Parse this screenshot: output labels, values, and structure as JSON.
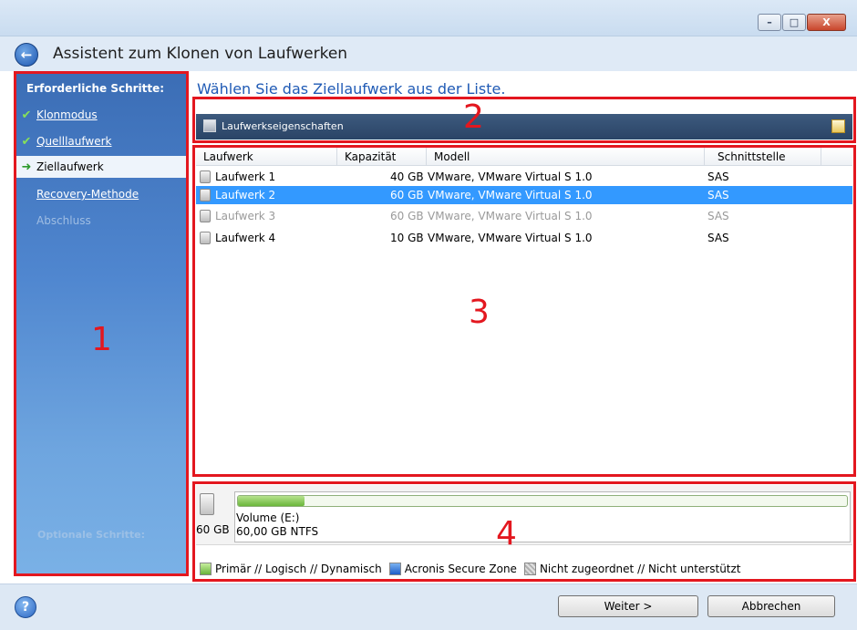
{
  "window": {
    "title": "Assistent zum Klonen von Laufwerken",
    "controls": {
      "minimize": "–",
      "maximize": "□",
      "close": "X"
    }
  },
  "sidebar": {
    "required_heading": "Erforderliche Schritte:",
    "steps": [
      {
        "label": "Klonmodus",
        "state": "done"
      },
      {
        "label": "Quelllaufwerk",
        "state": "done"
      },
      {
        "label": "Ziellaufwerk",
        "state": "current"
      },
      {
        "label": "Recovery-Methode",
        "state": "pending"
      },
      {
        "label": "Abschluss",
        "state": "disabled"
      }
    ],
    "optional_heading": "Optionale Schritte:"
  },
  "main": {
    "instruction": "Wählen Sie das Ziellaufwerk aus der Liste.",
    "toolbar": {
      "properties_label": "Laufwerkseigenschaften"
    },
    "table": {
      "columns": [
        "Laufwerk",
        "Kapazität",
        "Modell",
        "Schnittstelle"
      ],
      "rows": [
        {
          "drive": "Laufwerk 1",
          "capacity": "40 GB",
          "model": "VMware, VMware Virtual S 1.0",
          "interface": "SAS",
          "state": "normal"
        },
        {
          "drive": "Laufwerk 2",
          "capacity": "60 GB",
          "model": "VMware, VMware Virtual S 1.0",
          "interface": "SAS",
          "state": "selected"
        },
        {
          "drive": "Laufwerk 3",
          "capacity": "60 GB",
          "model": "VMware, VMware Virtual S 1.0",
          "interface": "SAS",
          "state": "disabled"
        },
        {
          "drive": "Laufwerk 4",
          "capacity": "10 GB",
          "model": "VMware, VMware Virtual S 1.0",
          "interface": "SAS",
          "state": "normal"
        }
      ]
    },
    "disk_map": {
      "disk_size": "60 GB",
      "volume_name": "Volume (E:)",
      "volume_info": "60,00 GB  NTFS",
      "used_fraction": 0.11
    },
    "legend": [
      {
        "label": "Primär // Logisch // Dynamisch",
        "color": "#6ab63a"
      },
      {
        "label": "Acronis Secure Zone",
        "color": "#1c5cc7"
      },
      {
        "label": "Nicht zugeordnet // Nicht unterstützt",
        "color": "#b0b0b0"
      }
    ]
  },
  "annotations": {
    "n1": "1",
    "n2": "2",
    "n3": "3",
    "n4": "4",
    "color": "#e3171f"
  },
  "footer": {
    "help_icon": "?",
    "next_label": "Weiter >",
    "cancel_label": "Abbrechen"
  }
}
